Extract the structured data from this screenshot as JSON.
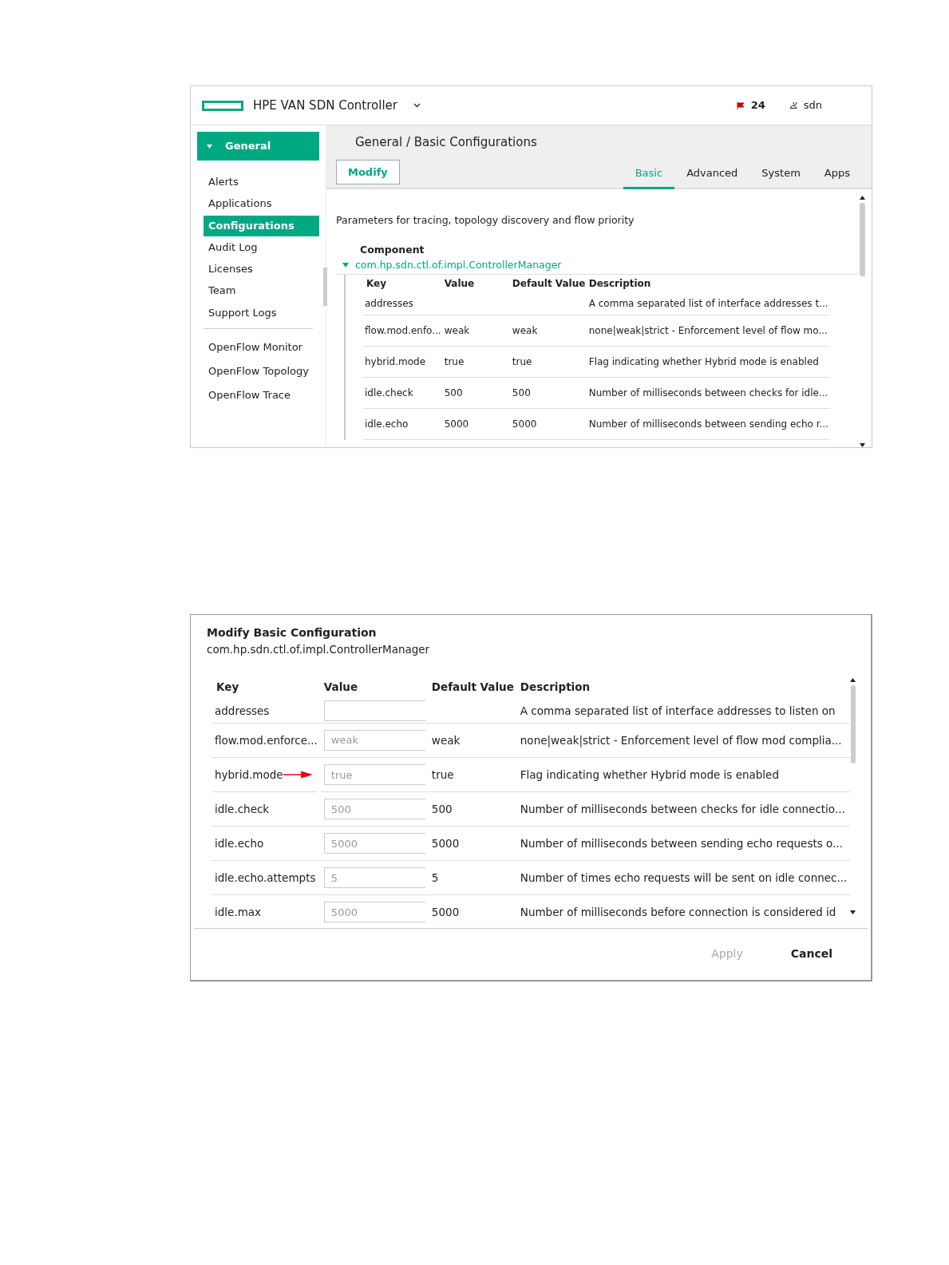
{
  "app_bar": {
    "title": "HPE VAN SDN Controller",
    "alerts_count": "24",
    "user": "sdn"
  },
  "sidebar": {
    "section": {
      "label": "General",
      "expanded": true
    },
    "groups": [
      [
        {
          "label": "Alerts",
          "selected": false
        },
        {
          "label": "Applications",
          "selected": false
        },
        {
          "label": "Configurations",
          "selected": true
        },
        {
          "label": "Audit Log",
          "selected": false
        },
        {
          "label": "Licenses",
          "selected": false
        },
        {
          "label": "Team",
          "selected": false
        },
        {
          "label": "Support Logs",
          "selected": false
        }
      ],
      [
        {
          "label": "OpenFlow Monitor",
          "selected": false
        },
        {
          "label": "OpenFlow Topology",
          "selected": false
        },
        {
          "label": "OpenFlow Trace",
          "selected": false
        }
      ]
    ]
  },
  "page_title": "General / Basic Configurations",
  "modify_button": "Modify",
  "tabs": [
    {
      "label": "Basic",
      "selected": true
    },
    {
      "label": "Advanced",
      "selected": false
    },
    {
      "label": "System",
      "selected": false
    },
    {
      "label": "Apps",
      "selected": false
    }
  ],
  "intro": "Parameters for tracing, topology discovery and flow priority",
  "component": {
    "heading": "Component",
    "name": "com.hp.sdn.ctl.of.impl.ControllerManager",
    "expanded": true
  },
  "table": {
    "columns": [
      "Key",
      "Value",
      "Default Value",
      "Description"
    ],
    "rows": [
      [
        "addresses",
        "",
        "",
        "A comma separated list of interface addresses t..."
      ],
      [
        "flow.mod.enfo...",
        "weak",
        "weak",
        "none|weak|strict - Enforcement level of flow mo..."
      ],
      [
        "hybrid.mode",
        "true",
        "true",
        "Flag indicating whether Hybrid mode is enabled"
      ],
      [
        "idle.check",
        "500",
        "500",
        "Number of milliseconds between checks for idle..."
      ],
      [
        "idle.echo",
        "5000",
        "5000",
        "Number of milliseconds between sending echo r..."
      ]
    ]
  },
  "dialog": {
    "title": "Modify Basic Configuration",
    "subtitle": "com.hp.sdn.ctl.of.impl.ControllerManager",
    "columns": [
      "Key",
      "Value",
      "Default Value",
      "Description"
    ],
    "rows": [
      {
        "key": "addresses",
        "placeholder": "",
        "default": "",
        "description": "A comma separated list of interface addresses to listen on",
        "annotated": false
      },
      {
        "key": "flow.mod.enforce...",
        "placeholder": "weak",
        "default": "weak",
        "description": "none|weak|strict - Enforcement level of flow mod complia...",
        "annotated": false
      },
      {
        "key": "hybrid.mode",
        "placeholder": "true",
        "default": "true",
        "description": "Flag indicating whether Hybrid mode is enabled",
        "annotated": true
      },
      {
        "key": "idle.check",
        "placeholder": "500",
        "default": "500",
        "description": "Number of milliseconds between checks for idle connectio...",
        "annotated": false
      },
      {
        "key": "idle.echo",
        "placeholder": "5000",
        "default": "5000",
        "description": "Number of milliseconds between sending echo requests o...",
        "annotated": false
      },
      {
        "key": "idle.echo.attempts",
        "placeholder": "5",
        "default": "5",
        "description": "Number of times echo requests will be sent on idle connec...",
        "annotated": false
      },
      {
        "key": "idle.max",
        "placeholder": "5000",
        "default": "5000",
        "description": "Number of milliseconds before connection is considered id",
        "annotated": false
      }
    ],
    "buttons": [
      {
        "label": "Apply",
        "disabled": true
      },
      {
        "label": "Cancel",
        "disabled": false
      }
    ]
  }
}
